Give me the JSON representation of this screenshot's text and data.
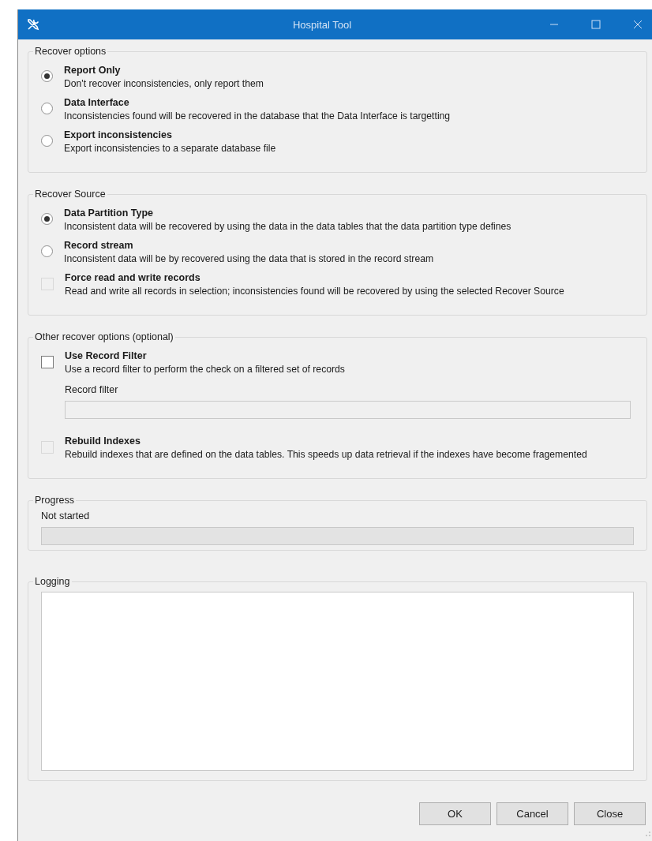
{
  "window": {
    "title": "Hospital Tool"
  },
  "groups": [
    {
      "title": "Recover options",
      "items": [
        {
          "kind": "radio",
          "label": "Report Only",
          "description": "Don't recover inconsistencies, only report them",
          "selected": true,
          "disabled": false
        },
        {
          "kind": "radio",
          "label": "Data Interface",
          "description": "Inconsistencies found will be recovered in the database that the Data Interface is targetting",
          "selected": false,
          "disabled": false
        },
        {
          "kind": "radio",
          "label": "Export inconsistencies",
          "description": "Export inconsistencies to a separate database file",
          "selected": false,
          "disabled": false
        }
      ]
    },
    {
      "title": "Recover Source",
      "items": [
        {
          "kind": "radio",
          "label": "Data Partition Type",
          "description": "Inconsistent data will be recovered by using the data in the data tables that the data partition type defines",
          "selected": true,
          "disabled": false
        },
        {
          "kind": "radio",
          "label": "Record stream",
          "description": "Inconsistent data will be by recovered using the data that is stored in the record stream",
          "selected": false,
          "disabled": false
        },
        {
          "kind": "checkbox",
          "label": "Force read and write records",
          "description": "Read and write all records in selection; inconsistencies found will be recovered by using the selected Recover Source",
          "checked": false,
          "disabled": true
        }
      ]
    },
    {
      "title": "Other recover options (optional)",
      "items": [
        {
          "kind": "checkbox",
          "label": "Use Record Filter",
          "description": "Use a record filter to perform the check on a filtered set of records",
          "checked": false,
          "disabled": false,
          "field_label": "Record filter"
        },
        {
          "kind": "checkbox",
          "label": "Rebuild Indexes",
          "description": "Rebuild indexes that are defined on the data tables. This speeds up data retrieval if the indexes have become fragemented",
          "checked": false,
          "disabled": true
        }
      ]
    }
  ],
  "progress": {
    "title": "Progress",
    "status": "Not started",
    "level": 0
  },
  "logging": {
    "title": "Logging"
  },
  "buttons": [
    "OK",
    "Cancel",
    "Close"
  ]
}
